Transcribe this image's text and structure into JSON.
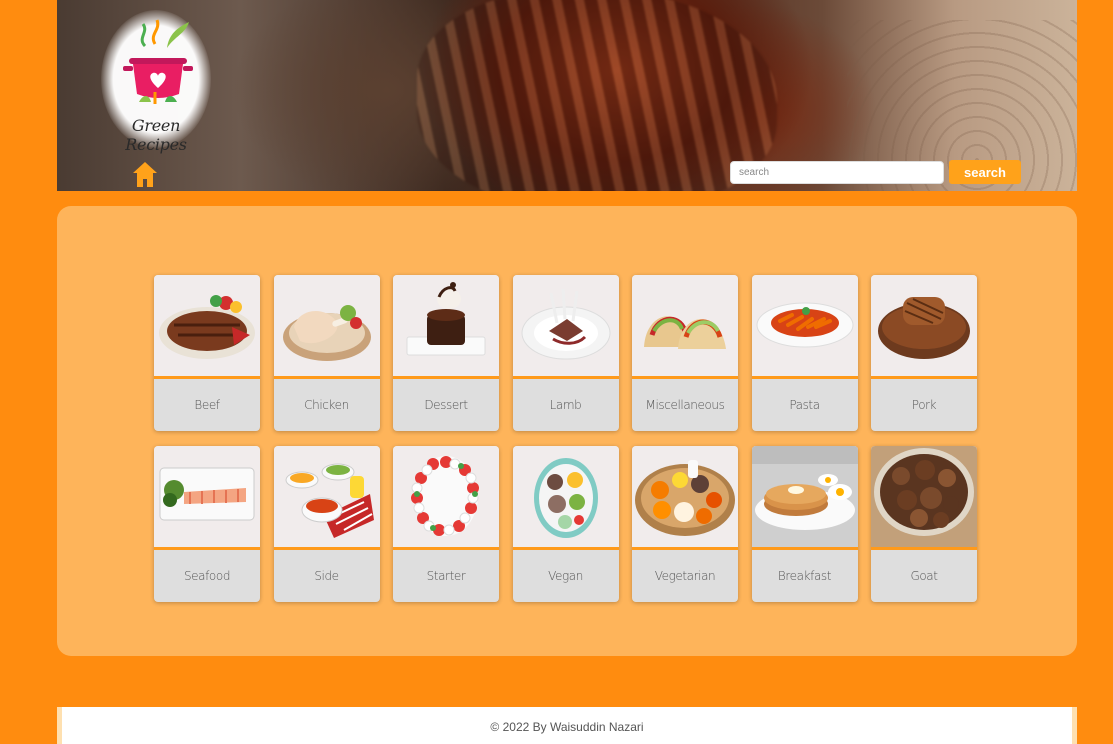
{
  "header": {
    "logo_text": "Green Recipes",
    "search_placeholder": "search",
    "search_button": "search",
    "home_icon": "home-icon"
  },
  "categories": [
    {
      "label": "Beef",
      "icon": "beef-steak"
    },
    {
      "label": "Chicken",
      "icon": "chicken-leg"
    },
    {
      "label": "Dessert",
      "icon": "chocolate-cake"
    },
    {
      "label": "Lamb",
      "icon": "lamb-rack"
    },
    {
      "label": "Miscellaneous",
      "icon": "tacos"
    },
    {
      "label": "Pasta",
      "icon": "pasta-bowl"
    },
    {
      "label": "Pork",
      "icon": "pork-chop"
    },
    {
      "label": "Seafood",
      "icon": "salmon-plate"
    },
    {
      "label": "Side",
      "icon": "side-bowls"
    },
    {
      "label": "Starter",
      "icon": "caprese-wreath"
    },
    {
      "label": "Vegan",
      "icon": "vegan-bowl"
    },
    {
      "label": "Vegetarian",
      "icon": "thali-platter"
    },
    {
      "label": "Breakfast",
      "icon": "pancakes"
    },
    {
      "label": "Goat",
      "icon": "goat-stew"
    }
  ],
  "footer": {
    "text": "© 2022 By Waisuddin Nazari"
  },
  "colors": {
    "page_bg": "#ff8c0f",
    "panel_bg": "#feb45a",
    "accent": "#ff9a1a",
    "search_button": "#ffa21a"
  }
}
